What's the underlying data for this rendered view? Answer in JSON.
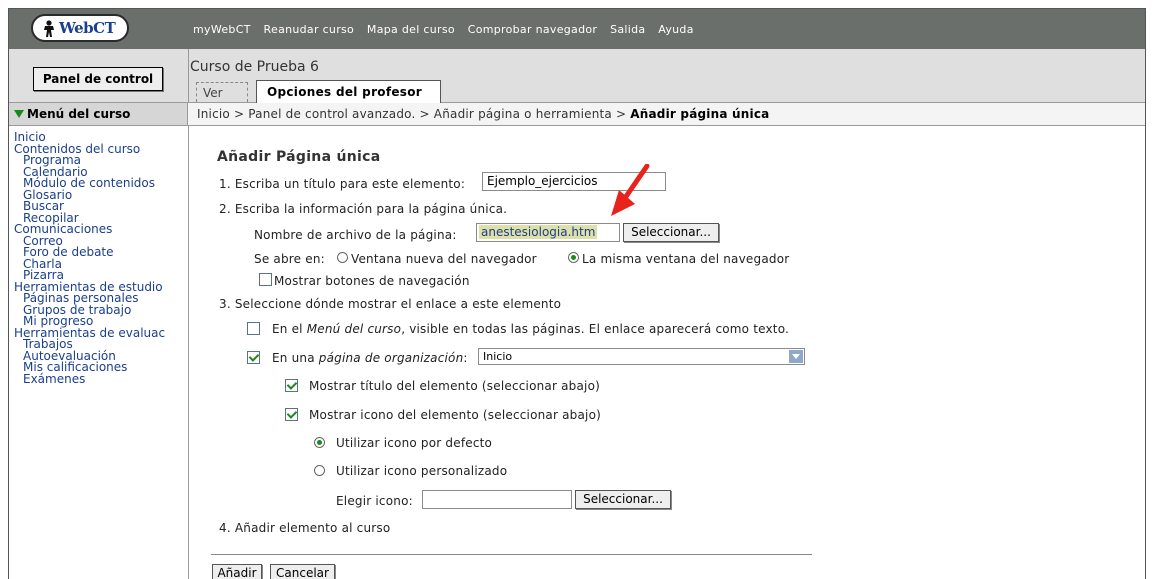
{
  "logo_text": "WebCT",
  "top_nav": [
    "myWebCT",
    "Reanudar curso",
    "Mapa del curso",
    "Comprobar navegador",
    "Salida",
    "Ayuda"
  ],
  "control_panel_label": "Panel de control",
  "course_title": "Curso de Prueba 6",
  "tabs": {
    "view": "Ver",
    "teacher": "Opciones del profesor"
  },
  "menu_heading": "Menú del curso",
  "breadcrumb": {
    "parts": [
      "Inicio",
      "Panel de control avanzado.",
      "Añadir página o herramienta"
    ],
    "separator": ">",
    "current": "Añadir página única"
  },
  "sidebar": {
    "items": [
      {
        "label": "Inicio",
        "level": 0
      },
      {
        "label": "Contenidos del curso",
        "level": 0
      },
      {
        "label": "Programa",
        "level": 1
      },
      {
        "label": "Calendario",
        "level": 1
      },
      {
        "label": "Módulo de contenidos",
        "level": 1
      },
      {
        "label": "Glosario",
        "level": 1
      },
      {
        "label": "Buscar",
        "level": 1
      },
      {
        "label": "Recopilar",
        "level": 1
      },
      {
        "label": "Comunicaciones",
        "level": 0
      },
      {
        "label": "Correo",
        "level": 1
      },
      {
        "label": "Foro de debate",
        "level": 1
      },
      {
        "label": "Charla",
        "level": 1
      },
      {
        "label": "Pizarra",
        "level": 1
      },
      {
        "label": "Herramientas de estudio",
        "level": 0
      },
      {
        "label": "Páginas personales",
        "level": 1
      },
      {
        "label": "Grupos de trabajo",
        "level": 1
      },
      {
        "label": "Mi progreso",
        "level": 1
      },
      {
        "label": "Herramientas de evaluac",
        "level": 0
      },
      {
        "label": "Trabajos",
        "level": 1
      },
      {
        "label": "Autoevaluación",
        "level": 1
      },
      {
        "label": "Mis calificaciones",
        "level": 1
      },
      {
        "label": "Exámenes",
        "level": 1
      }
    ]
  },
  "form": {
    "heading": "Añadir Página única",
    "step1_label": "1. Escriba un título para este elemento:",
    "step1_value": "Ejemplo_ejercicios",
    "step2_label": "2. Escriba la información para la página única.",
    "file_label": "Nombre de archivo de la página:",
    "file_value": "anestesiologia.htm",
    "select_button": "Seleccionar...",
    "opens_in_label": "Se abre en:",
    "radio_new_window": "Ventana nueva del navegador",
    "radio_same_window": "La misma ventana del navegador",
    "show_nav_buttons": "Mostrar botones de navegación",
    "step3_label": "3. Seleccione dónde mostrar el enlace a este elemento",
    "menu_option_prefix": "En el ",
    "menu_option_italic": "Menú del curso",
    "menu_option_suffix": ", visible en todas las páginas. El enlace aparecerá como texto.",
    "org_option_prefix": "En una ",
    "org_option_italic": "página de organización",
    "org_option_suffix": ":",
    "org_select_value": "Inicio",
    "show_title": "Mostrar título del elemento (seleccionar abajo)",
    "show_icon": "Mostrar icono del elemento (seleccionar abajo)",
    "default_icon": "Utilizar icono por defecto",
    "custom_icon": "Utilizar icono personalizado",
    "choose_icon_label": "Elegir icono:",
    "choose_icon_value": "",
    "step4_label": "4. Añadir elemento al curso",
    "add_button": "Añadir",
    "cancel_button": "Cancelar"
  },
  "colors": {
    "arrow": "#e8231c",
    "link": "#1a3f8c",
    "check": "#1a8a1a"
  }
}
